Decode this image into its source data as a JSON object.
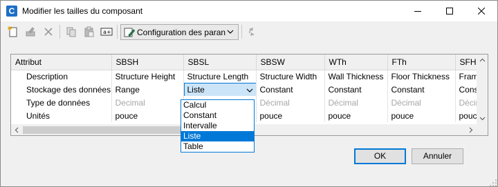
{
  "window": {
    "app_icon_letter": "C",
    "title": "Modifier les tailles du composant"
  },
  "toolbar": {
    "config_label": "Configuration des paran",
    "icons": [
      "new-icon",
      "edit-icon",
      "delete-icon",
      "copy-icon",
      "paste-icon",
      "rename-icon",
      "config-icon",
      "refresh-icon"
    ]
  },
  "grid": {
    "headers": [
      "Attribut",
      "SBSH",
      "SBSL",
      "SBSW",
      "WTh",
      "FTh",
      "SFH"
    ],
    "rows": [
      {
        "label": "Description",
        "cells": [
          "Structure Height",
          "Structure Length",
          "Structure Width",
          "Wall Thickness",
          "Floor Thickness",
          "Fram"
        ],
        "grey": false
      },
      {
        "label": "Stockage des données",
        "cells": [
          "Range",
          "Liste",
          "Constant",
          "Constant",
          "Constant",
          "Cons"
        ],
        "grey": false
      },
      {
        "label": "Type de données",
        "cells": [
          "Decimal",
          "",
          "Décimal",
          "Décimal",
          "Décimal",
          "Décir"
        ],
        "grey": true
      },
      {
        "label": "Unités",
        "cells": [
          "pouce",
          "",
          "pouce",
          "pouce",
          "pouce",
          "pouc"
        ],
        "grey": false
      }
    ]
  },
  "dropdown": {
    "options": [
      "Calcul",
      "Constant",
      "Intervalle",
      "Liste",
      "Table"
    ],
    "selected_index": 3
  },
  "buttons": {
    "ok": "OK",
    "cancel": "Annuler"
  },
  "colors": {
    "accent": "#0078d7",
    "selection_bg": "#cce4f7"
  }
}
